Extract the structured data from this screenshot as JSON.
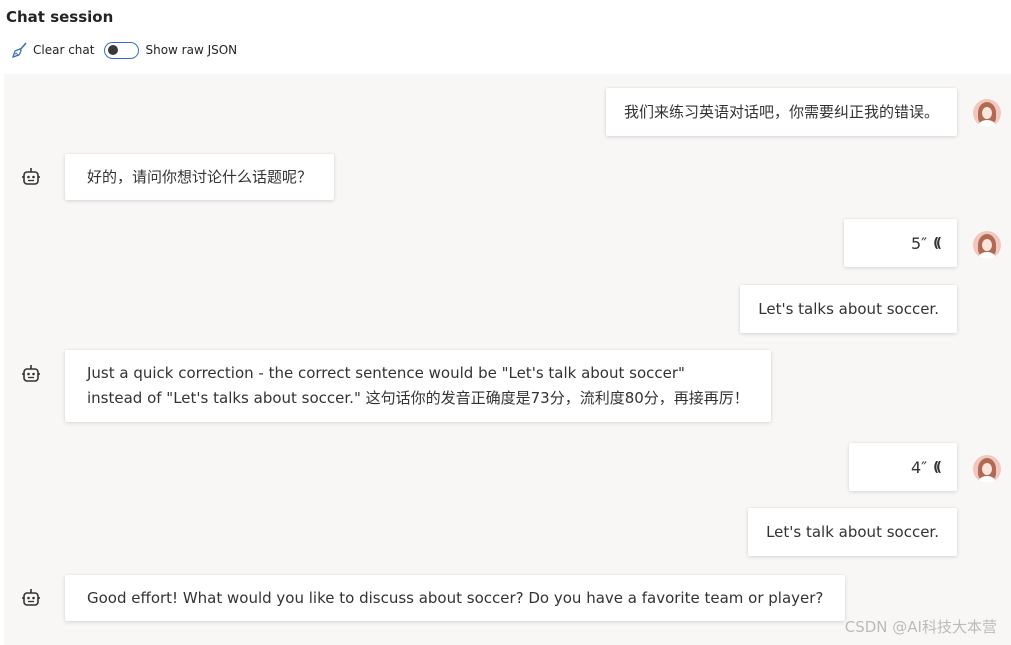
{
  "header": {
    "title": "Chat session",
    "clear_label": "Clear chat",
    "toggle_label": "Show raw JSON"
  },
  "messages": [
    {
      "role": "user",
      "text": "我们来练习英语对话吧，你需要纠正我的错误。"
    },
    {
      "role": "bot",
      "text": "好的，请问你想讨论什么话题呢？"
    },
    {
      "role": "user",
      "voice": "5″"
    },
    {
      "role": "user",
      "text": "Let's talks about soccer."
    },
    {
      "role": "bot",
      "lines": [
        "Just a quick correction - the correct sentence would be \"Let's talk about soccer\"",
        "instead of \"Let's talks about soccer.\" 这句话你的发音正确度是73分，流利度80分，再接再厉！"
      ]
    },
    {
      "role": "user",
      "voice": "4″"
    },
    {
      "role": "user",
      "text": "Let's talk about soccer."
    },
    {
      "role": "bot",
      "text": "Good effort!  What would you like to discuss about soccer? Do you have a favorite team or player?"
    }
  ],
  "watermark": "CSDN @AI科技大本营",
  "colors": {
    "toggle_border": "#3a6fc8",
    "chat_background": "#f8f7f6",
    "bubble": "#ffffff"
  },
  "icons": {
    "clear": "broom-icon",
    "bot": "bot-icon",
    "user": "user-avatar",
    "voice": "voice-wave-icon"
  }
}
